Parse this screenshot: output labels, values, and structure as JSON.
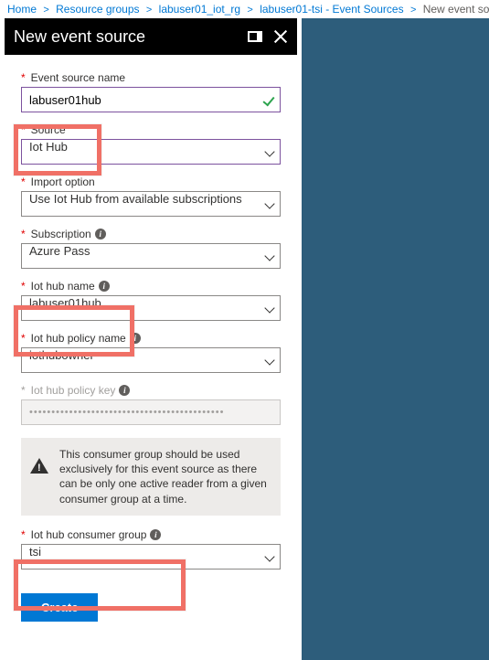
{
  "breadcrumb": {
    "home": "Home",
    "rg": "Resource groups",
    "rg_name": "labuser01_iot_rg",
    "tsi": "labuser01-tsi - Event Sources",
    "current": "New event source"
  },
  "header": {
    "title": "New event source"
  },
  "fields": {
    "name_label": "Event source name",
    "name_value": "labuser01hub",
    "source_label": "Source",
    "source_value": "Iot Hub",
    "import_label": "Import option",
    "import_value": "Use Iot Hub from available subscriptions",
    "sub_label": "Subscription",
    "sub_value": "Azure Pass",
    "hubname_label": "Iot hub name",
    "hubname_value": "labuser01hub",
    "policy_label": "Iot hub policy name",
    "policy_value": "iothubowner",
    "key_label": "Iot hub policy key",
    "key_value": "••••••••••••••••••••••••••••••••••••••••••••",
    "cg_label": "Iot hub consumer group",
    "cg_value": "tsi"
  },
  "notice": "This consumer group should be used exclusively for this event source as there can be only one active reader from a given consumer group at a time.",
  "buttons": {
    "create": "Create"
  }
}
